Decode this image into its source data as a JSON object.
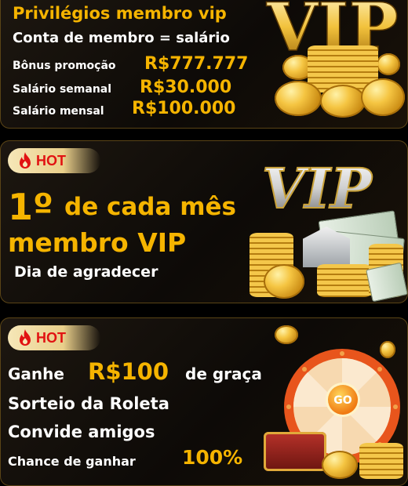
{
  "card1": {
    "title": "Privilégios membro vip",
    "line2": "Conta de membro = salário",
    "bonus_label": "Bônus promoção",
    "bonus_value": "R$777.777",
    "weekly_label": "Salário semanal",
    "weekly_value": "R$30.000",
    "monthly_label": "Salário mensal",
    "monthly_value": "R$100.000",
    "logo": "VIP"
  },
  "card2": {
    "badge": "HOT",
    "badge_icon": "flame-icon",
    "number": "1º",
    "line1_rest": "de cada mês",
    "line2": "membro VIP",
    "line3": "Dia de agradecer",
    "logo": "VIP"
  },
  "card3": {
    "badge": "HOT",
    "badge_icon": "flame-icon",
    "win_prefix": "Ganhe",
    "win_amount": "R$100",
    "win_suffix": "de graça",
    "line2": "Sorteio da Roleta",
    "line3": "Convide amigos",
    "chance_label": "Chance de ganhar",
    "chance_value": "100%",
    "wheel_button": "GO"
  },
  "colors": {
    "gold": "#f5b400",
    "white": "#ffffff",
    "hot_red": "#e11212"
  }
}
